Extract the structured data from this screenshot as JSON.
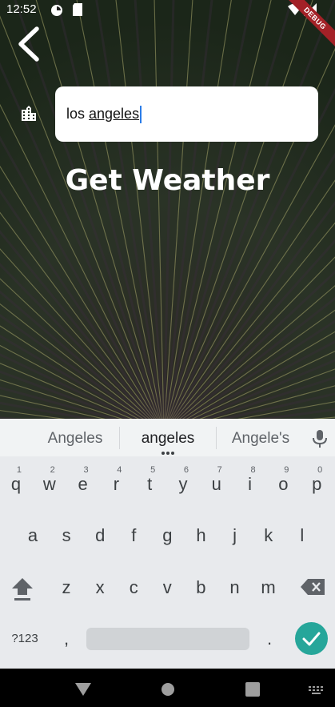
{
  "status_bar": {
    "time": "12:52",
    "debug_banner": "DEBUG"
  },
  "city_input": {
    "value_prefix": "los ",
    "value_underlined": "angeles"
  },
  "title": "Get Weather",
  "keyboard": {
    "suggestions": [
      "Angeles",
      "angeles",
      "Angele's"
    ],
    "row1": [
      {
        "k": "q",
        "h": "1"
      },
      {
        "k": "w",
        "h": "2"
      },
      {
        "k": "e",
        "h": "3"
      },
      {
        "k": "r",
        "h": "4"
      },
      {
        "k": "t",
        "h": "5"
      },
      {
        "k": "y",
        "h": "6"
      },
      {
        "k": "u",
        "h": "7"
      },
      {
        "k": "i",
        "h": "8"
      },
      {
        "k": "o",
        "h": "9"
      },
      {
        "k": "p",
        "h": "0"
      }
    ],
    "row2": [
      "a",
      "s",
      "d",
      "f",
      "g",
      "h",
      "j",
      "k",
      "l"
    ],
    "row3": [
      "z",
      "x",
      "c",
      "v",
      "b",
      "n",
      "m"
    ],
    "symbols_label": "?123",
    "comma": ",",
    "period": "."
  },
  "icons": {
    "back": "back-arrow-icon",
    "city": "location-city-icon",
    "mic": "microphone-icon",
    "shift": "shift-icon",
    "backspace": "backspace-icon",
    "enter": "check-icon"
  }
}
